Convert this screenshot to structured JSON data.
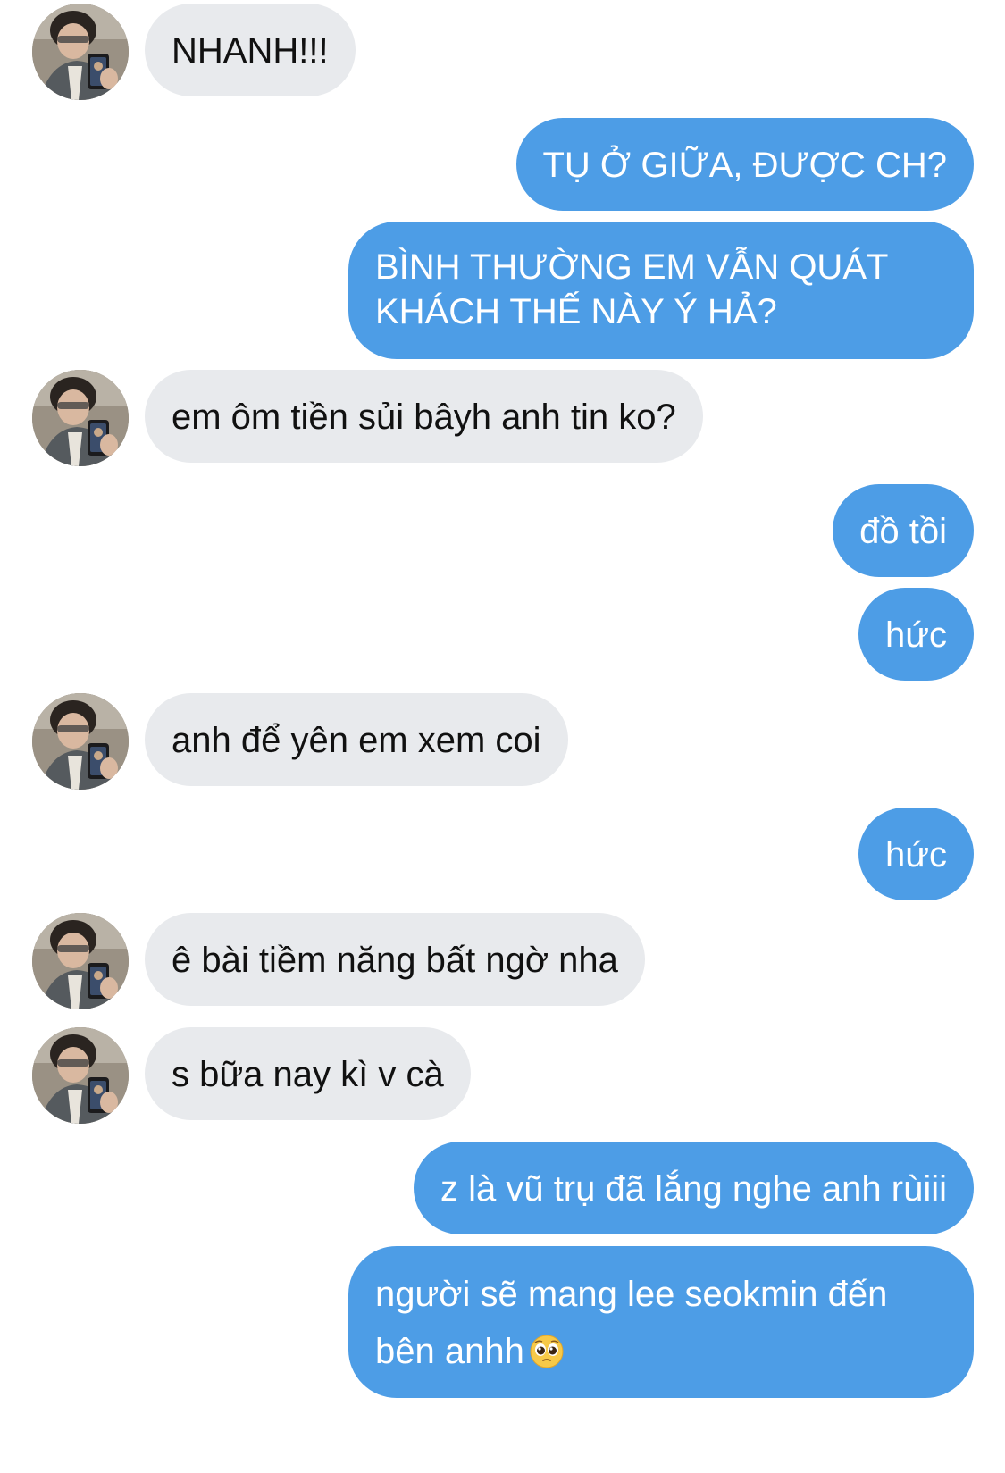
{
  "conversation": {
    "messages": [
      {
        "sender": "them",
        "text": "NHANH!!!"
      },
      {
        "sender": "me",
        "text": "TỤ Ở GIỮA, ĐƯỢC CH?"
      },
      {
        "sender": "me",
        "lines": [
          "BÌNH THƯỜNG EM VẪN QUÁT",
          "KHÁCH THẾ NÀY Ý HẢ?"
        ]
      },
      {
        "sender": "them",
        "text": "em ôm tiền sủi bâyh anh tin ko?"
      },
      {
        "sender": "me",
        "text": "đồ tồi"
      },
      {
        "sender": "me",
        "text": "hức"
      },
      {
        "sender": "them",
        "text": "anh để yên em xem coi"
      },
      {
        "sender": "me",
        "text": "hức"
      },
      {
        "sender": "them",
        "text": "ê bài tiềm năng bất ngờ nha"
      },
      {
        "sender": "them",
        "text": "s bữa nay kì v cà"
      },
      {
        "sender": "me",
        "text": "z là vũ trụ đã lắng nghe anh rùiii"
      },
      {
        "sender": "me",
        "lines": [
          "người sẽ mang lee seokmin đến",
          "bên anhh"
        ],
        "emoji": "pleading-face-emoji"
      }
    ]
  },
  "colors": {
    "incoming_bubble": "#e8eaed",
    "outgoing_bubble": "#4d9de6",
    "outgoing_text": "#ffffff",
    "incoming_text": "#111111"
  }
}
